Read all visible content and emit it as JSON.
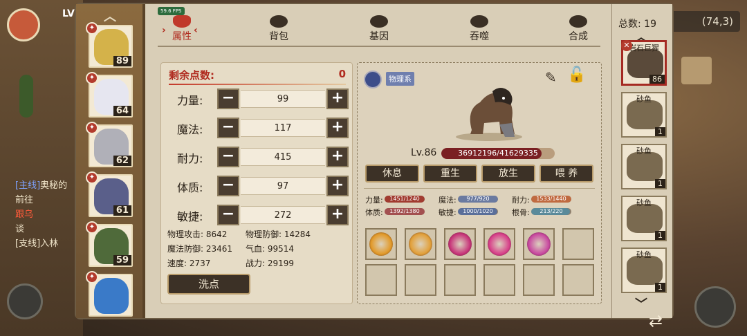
{
  "hud": {
    "coords": "(74,3)",
    "fps": "59.6 FPS",
    "quest_tag": "[主线]",
    "quest_title": "奥秘的",
    "quest_line2": "前往",
    "quest_line3": "跟乌",
    "quest_line4": "谈",
    "quest_line5": "[支线]入林"
  },
  "tabs": [
    {
      "label": "属性",
      "icon": "flame-icon"
    },
    {
      "label": "背包",
      "icon": "bag-icon"
    },
    {
      "label": "基因",
      "icon": "gene-icon"
    },
    {
      "label": "吞噬",
      "icon": "devour-icon"
    },
    {
      "label": "合成",
      "icon": "synthesis-icon"
    }
  ],
  "heroes": [
    {
      "level": "89",
      "color": "#d4b24a"
    },
    {
      "level": "64",
      "color": "#e6e6f0"
    },
    {
      "level": "62",
      "color": "#b0b0b8"
    },
    {
      "level": "61",
      "color": "#5a5f8a"
    },
    {
      "level": "59",
      "color": "#4f6a3a"
    },
    {
      "level": "",
      "color": "#3a7ac8"
    }
  ],
  "attributes": {
    "remain_label": "剩余点数:",
    "remain_value": "0",
    "stats": [
      {
        "name": "力量:",
        "value": "99"
      },
      {
        "name": "魔法:",
        "value": "117"
      },
      {
        "name": "耐力:",
        "value": "415"
      },
      {
        "name": "体质:",
        "value": "97"
      },
      {
        "name": "敏捷:",
        "value": "272"
      }
    ],
    "derived": [
      {
        "text": "物理攻击: 8642"
      },
      {
        "text": "物理防御: 14284"
      },
      {
        "text": "魔法防御: 23461"
      },
      {
        "text": "气血: 99514"
      },
      {
        "text": "速度: 2737"
      },
      {
        "text": "战力: 29199"
      }
    ],
    "reset_label": "洗点"
  },
  "pet": {
    "type_label": "物理系",
    "level": "Lv.86",
    "hp_text": "36912196/41629335",
    "hp_fraction": 0.887,
    "actions": [
      "休息",
      "重生",
      "放生",
      "喂 养"
    ],
    "potentials": [
      {
        "name": "力量:",
        "value": "1451/1240",
        "fraction": 1.0,
        "color": "#a13b30"
      },
      {
        "name": "魔法:",
        "value": "977/920",
        "fraction": 1.0,
        "color": "#6a7aa0"
      },
      {
        "name": "耐力:",
        "value": "1533/1440",
        "fraction": 1.0,
        "color": "#c06a40"
      },
      {
        "name": "体质:",
        "value": "1392/1380",
        "fraction": 1.0,
        "color": "#a35050"
      },
      {
        "name": "敏捷:",
        "value": "1000/1020",
        "fraction": 0.98,
        "color": "#5a6f9a"
      },
      {
        "name": "根骨:",
        "value": "213/220",
        "fraction": 0.97,
        "color": "#5a8a9a"
      }
    ],
    "skills": [
      {
        "icon": "fist-skill-icon",
        "color": "#e29a2a"
      },
      {
        "icon": "sun-skill-icon",
        "color": "#e2a03a"
      },
      {
        "icon": "crystal-skill-icon",
        "color": "#c8357a"
      },
      {
        "icon": "vortex-skill-icon",
        "color": "#d8418a"
      },
      {
        "icon": "demon-skill-icon",
        "color": "#c94aa0"
      }
    ]
  },
  "roster": {
    "total_label": "总数: 19",
    "cards": [
      {
        "name": "岩石巨猩",
        "level": "86",
        "color": "#5a4a3a"
      },
      {
        "name": "砂鱼",
        "level": "1",
        "color": "#7a6a50"
      },
      {
        "name": "砂鱼",
        "level": "1",
        "color": "#7a6a50"
      },
      {
        "name": "砂鱼",
        "level": "1",
        "color": "#7a6a50"
      },
      {
        "name": "砂鱼",
        "level": "1",
        "color": "#7a6a50"
      }
    ]
  }
}
